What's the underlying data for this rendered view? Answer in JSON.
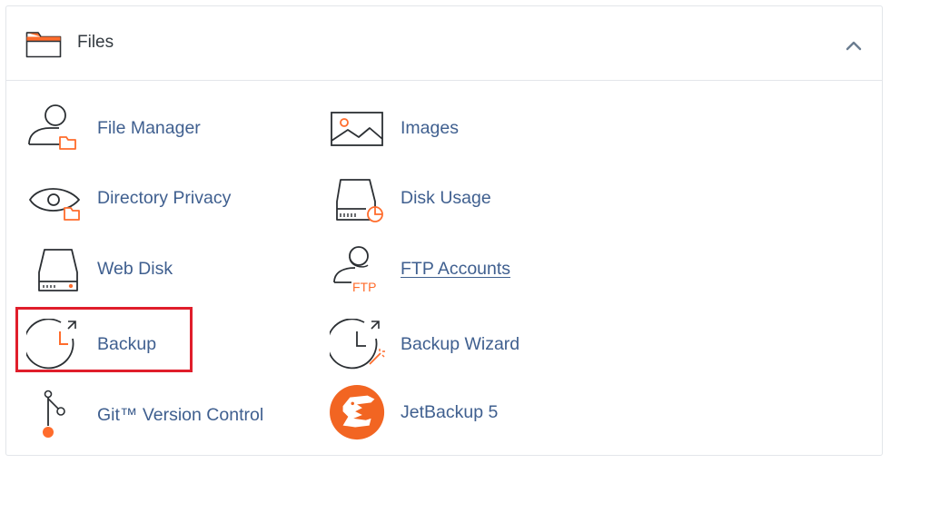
{
  "panel": {
    "title": "Files",
    "title_icon": "folder-icon",
    "collapse_icon": "chevron-up-icon"
  },
  "colors": {
    "accent": "#ff6c2c",
    "label_blue": "#3f5f8f",
    "icon_stroke": "#2b2f33",
    "highlight_red": "#e01e2b"
  },
  "items": [
    {
      "label": "File Manager",
      "icon": "file-manager-icon"
    },
    {
      "label": "Images",
      "icon": "images-icon"
    },
    {
      "label": "Directory Privacy",
      "icon": "directory-privacy-icon"
    },
    {
      "label": "Disk Usage",
      "icon": "disk-usage-icon"
    },
    {
      "label": "Web Disk",
      "icon": "web-disk-icon"
    },
    {
      "label": "FTP Accounts",
      "icon": "ftp-accounts-icon",
      "icon_text": "FTP"
    },
    {
      "label": "Backup",
      "icon": "backup-icon"
    },
    {
      "label": "Backup Wizard",
      "icon": "backup-wizard-icon"
    },
    {
      "label": "Git™ Version Control",
      "icon": "git-version-control-icon"
    },
    {
      "label": "JetBackup 5",
      "icon": "jetbackup-icon"
    }
  ]
}
